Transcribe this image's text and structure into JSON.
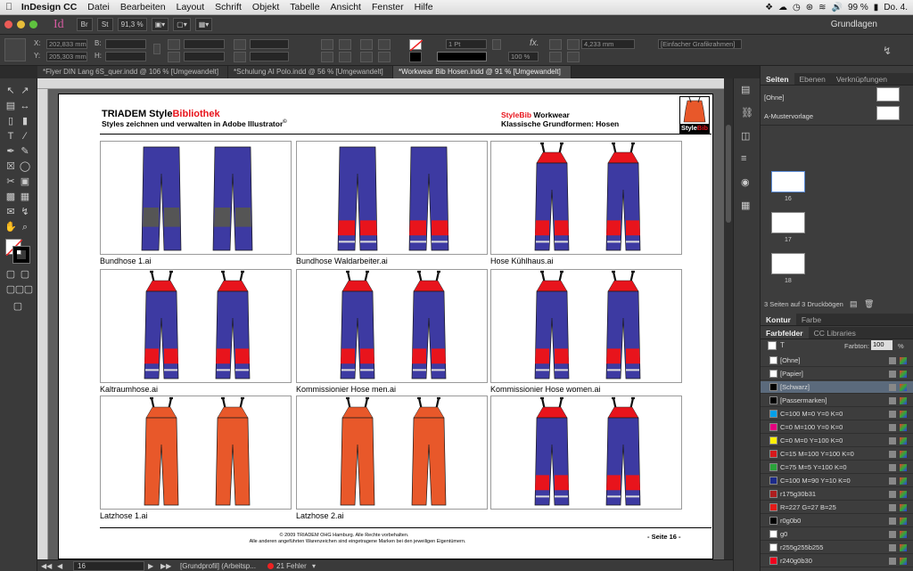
{
  "menubar": {
    "app": "InDesign CC",
    "items": [
      "Datei",
      "Bearbeiten",
      "Layout",
      "Schrift",
      "Objekt",
      "Tabelle",
      "Ansicht",
      "Fenster",
      "Hilfe"
    ],
    "battery": "99 %",
    "clock": "Do. 4."
  },
  "appbar": {
    "logo": "Id",
    "btn_br": "Br",
    "btn_st": "St",
    "zoom": "91,3 %",
    "workspace": "Grundlagen"
  },
  "control": {
    "x_label": "X:",
    "y_label": "Y:",
    "x_value": "202,833 mm",
    "y_value": "205,303 mm",
    "b_label": "B:",
    "h_label": "H:",
    "stroke_weight": "1 Pt",
    "percent": "100 %",
    "size_value": "4,233 mm",
    "frame_style": "[Einfacher Grafikrahmen]"
  },
  "tabs": [
    {
      "label": "*Flyer DIN Lang 6S_quer.indd @ 106 % [Umgewandelt]"
    },
    {
      "label": "*Schulung AI Polo.indd @ 56 % [Umgewandelt]"
    },
    {
      "label": "*Workwear Bib Hosen.indd @ 91 % [Umgewandelt]"
    }
  ],
  "document": {
    "title_black": "TRIADEM Style",
    "title_red": "Bibliothek",
    "subtitle": "Styles zeichnen und verwalten in Adobe Illustrator",
    "reg_mark": "©",
    "right_title_red": "StyleBib",
    "right_title_black": " Workwear",
    "right_subtitle": "Klassische Grundformen: Hosen",
    "logo_text_white": "Style",
    "logo_text_red": "Bib",
    "footer_line1": "© 2009 TRIADEM OHG Hamburg. Alle Rechte vorbehalten.",
    "footer_line2": "Alle anderen angeführten Warenzeichen sind eingetragene Marken bei den jeweiligen Eigentümern.",
    "page_label": "- Seite 16 -",
    "cells": [
      {
        "caption": "Bundhose 1.ai",
        "color": "#3d3aa2",
        "bib": false,
        "accent": "#555555"
      },
      {
        "caption": "Bundhose Waldarbeiter.ai",
        "color": "#3d3aa2",
        "bib": false,
        "accent": "#e8141c"
      },
      {
        "caption": "Hose Kühlhaus.ai",
        "color": "#3d3aa2",
        "bib": true,
        "accent": "#e8141c"
      },
      {
        "caption": "Kaltraumhose.ai",
        "color": "#3d3aa2",
        "bib": true,
        "accent": "#e8141c"
      },
      {
        "caption": "Kommissionier Hose men.ai",
        "color": "#3d3aa2",
        "bib": true,
        "accent": "#e8141c"
      },
      {
        "caption": "Kommissionier Hose women.ai",
        "color": "#3d3aa2",
        "bib": true,
        "accent": "#e8141c"
      },
      {
        "caption": "Latzhose 1.ai",
        "color": "#e8582a",
        "bib": true,
        "accent": "#e8582a"
      },
      {
        "caption": "Latzhose 2.ai",
        "color": "#e8582a",
        "bib": true,
        "accent": "#e8582a"
      },
      {
        "caption": "",
        "color": "#3d3aa2",
        "bib": true,
        "accent": "#e8141c"
      }
    ]
  },
  "status": {
    "page": "16",
    "profile": "[Grundprofil] (Arbeitsp...",
    "errors": "21 Fehler"
  },
  "panels": {
    "pages_tabs": [
      "Seiten",
      "Ebenen",
      "Verknüpfungen"
    ],
    "none_master": "[Ohne]",
    "a_master": "A-Mustervorlage",
    "page_numbers": [
      "16",
      "17",
      "18"
    ],
    "pages_info": "3 Seiten auf 3 Druckbögen",
    "contour_tabs": [
      "Kontur",
      "Farbe"
    ],
    "swatch_tabs": [
      "Farbfelder",
      "CC Libraries"
    ],
    "tint_label": "Farbton:",
    "tint_value": "100",
    "tint_unit": "%",
    "swatches": [
      {
        "name": "[Ohne]",
        "color": "#ffffff"
      },
      {
        "name": "[Papier]",
        "color": "#ffffff"
      },
      {
        "name": "[Schwarz]",
        "color": "#000000",
        "selected": true
      },
      {
        "name": "[Passermarken]",
        "color": "#000000"
      },
      {
        "name": "C=100 M=0 Y=0 K=0",
        "color": "#00a0e9"
      },
      {
        "name": "C=0 M=100 Y=0 K=0",
        "color": "#e4007f"
      },
      {
        "name": "C=0 M=0 Y=100 K=0",
        "color": "#fff100"
      },
      {
        "name": "C=15 M=100 Y=100 K=0",
        "color": "#d7191c"
      },
      {
        "name": "C=75 M=5 Y=100 K=0",
        "color": "#2aa33a"
      },
      {
        "name": "C=100 M=90 Y=10 K=0",
        "color": "#1d2b8a"
      },
      {
        "name": "r175g30b31",
        "color": "#af1e1f"
      },
      {
        "name": "R=227 G=27 B=25",
        "color": "#e31b19"
      },
      {
        "name": "r0g0b0",
        "color": "#000000"
      },
      {
        "name": "g0",
        "color": "#ffffff"
      },
      {
        "name": "r255g255b255",
        "color": "#ffffff"
      },
      {
        "name": "r240g0b30",
        "color": "#f0001e"
      }
    ]
  }
}
